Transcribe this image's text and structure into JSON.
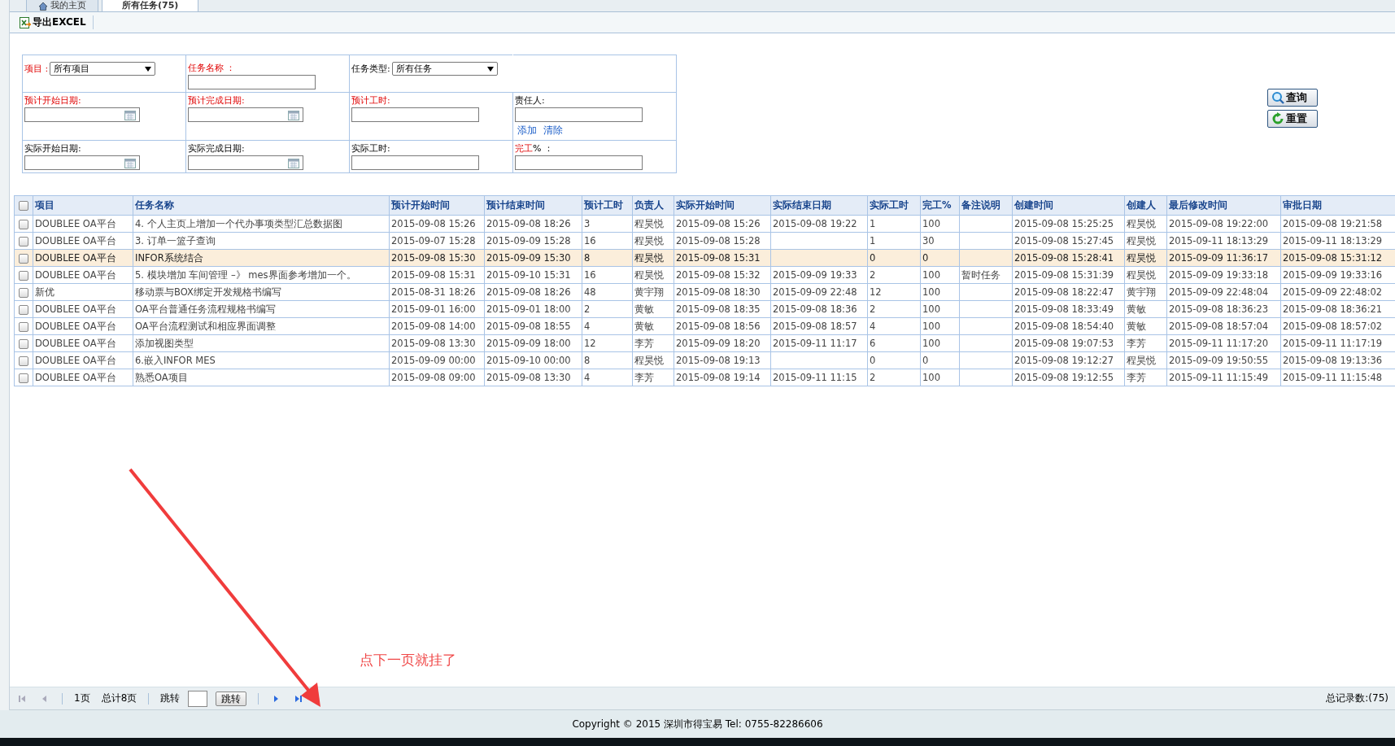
{
  "tabs": [
    {
      "label": "我的主页",
      "selected": false,
      "icon": true
    },
    {
      "label": "所有任务(75)",
      "selected": true,
      "icon": false
    }
  ],
  "toolbar": {
    "export_button": "导出EXCEL"
  },
  "filters": {
    "rows": [
      [
        {
          "label": "项目 :",
          "required": true,
          "kind": "select",
          "value": "所有项目"
        },
        {
          "label": "任务名称 ：",
          "required": true,
          "kind": "text"
        },
        {
          "label": "任务类型:",
          "required": false,
          "kind": "select",
          "value": "所有任务"
        }
      ],
      [
        {
          "label": "预计开始日期:",
          "required": true,
          "kind": "date"
        },
        {
          "label": "预计完成日期:",
          "required": true,
          "kind": "date"
        },
        {
          "label": "预计工时:",
          "required": true,
          "kind": "text"
        },
        {
          "label": "责任人:",
          "required": false,
          "kind": "person",
          "links": [
            "添加",
            "清除"
          ]
        }
      ],
      [
        {
          "label": "实际开始日期:",
          "required": false,
          "kind": "date"
        },
        {
          "label": "实际完成日期:",
          "required": false,
          "kind": "date"
        },
        {
          "label": "实际工时:",
          "required": false,
          "kind": "text"
        },
        {
          "label": "完工",
          "suffix": "% ：",
          "required": true,
          "kind": "text"
        }
      ]
    ],
    "buttons": [
      {
        "label": "查询",
        "kind": "search"
      },
      {
        "label": "重置",
        "kind": "reset"
      }
    ]
  },
  "table": {
    "select_all": {
      "checked": false
    },
    "columns": [
      "项目",
      "任务名称",
      "预计开始时间",
      "预计结束时间",
      "预计工时",
      "负责人",
      "实际开始时间",
      "实际结束日期",
      "实际工时",
      "完工%",
      "备注说明",
      "创建时间",
      "创建人",
      "最后修改时间",
      "审批日期"
    ],
    "rows": [
      {
        "checked": false,
        "selected": false,
        "cells": [
          "DOUBLEE OA平台",
          "4. 个人主页上增加一个代办事项类型汇总数据图",
          "2015-09-08 15:26",
          "2015-09-08 18:26",
          "3",
          "程昊悦",
          "2015-09-08 15:26",
          "2015-09-08 19:22",
          "1",
          "100",
          "",
          "2015-09-08 15:25:25",
          "程昊悦",
          "2015-09-08 19:22:00",
          "2015-09-08 19:21:58"
        ]
      },
      {
        "checked": false,
        "selected": false,
        "cells": [
          "DOUBLEE OA平台",
          "3. 订单一篮子查询",
          "2015-09-07 15:28",
          "2015-09-09 15:28",
          "16",
          "程昊悦",
          "2015-09-08 15:28",
          "",
          "1",
          "30",
          "",
          "2015-09-08 15:27:45",
          "程昊悦",
          "2015-09-11 18:13:29",
          "2015-09-11 18:13:29"
        ]
      },
      {
        "checked": false,
        "selected": true,
        "cells": [
          "DOUBLEE OA平台",
          "INFOR系统结合",
          "2015-09-08 15:30",
          "2015-09-09 15:30",
          "8",
          "程昊悦",
          "2015-09-08 15:31",
          "",
          "0",
          "0",
          "",
          "2015-09-08 15:28:41",
          "程昊悦",
          "2015-09-09 11:36:17",
          "2015-09-08 15:31:12"
        ]
      },
      {
        "checked": false,
        "selected": false,
        "cells": [
          "DOUBLEE OA平台",
          "5. 模块增加 车间管理 –》 mes界面参考增加一个。",
          "2015-09-08 15:31",
          "2015-09-10 15:31",
          "16",
          "程昊悦",
          "2015-09-08 15:32",
          "2015-09-09 19:33",
          "2",
          "100",
          "暂时任务",
          "2015-09-08 15:31:39",
          "程昊悦",
          "2015-09-09 19:33:18",
          "2015-09-09 19:33:16"
        ]
      },
      {
        "checked": false,
        "selected": false,
        "cells": [
          "新优",
          "移动票与BOX绑定开发规格书编写",
          "2015-08-31 18:26",
          "2015-09-08 18:26",
          "48",
          "黄宇翔",
          "2015-09-08 18:30",
          "2015-09-09 22:48",
          "12",
          "100",
          "",
          "2015-09-08 18:22:47",
          "黄宇翔",
          "2015-09-09 22:48:04",
          "2015-09-09 22:48:02"
        ]
      },
      {
        "checked": false,
        "selected": false,
        "cells": [
          "DOUBLEE OA平台",
          "OA平台普通任务流程规格书编写",
          "2015-09-01 16:00",
          "2015-09-01 18:00",
          "2",
          "黄敏",
          "2015-09-08 18:35",
          "2015-09-08 18:36",
          "2",
          "100",
          "",
          "2015-09-08 18:33:49",
          "黄敏",
          "2015-09-08 18:36:23",
          "2015-09-08 18:36:21"
        ]
      },
      {
        "checked": false,
        "selected": false,
        "cells": [
          "DOUBLEE OA平台",
          "OA平台流程测试和相应界面调整",
          "2015-09-08 14:00",
          "2015-09-08 18:55",
          "4",
          "黄敏",
          "2015-09-08 18:56",
          "2015-09-08 18:57",
          "4",
          "100",
          "",
          "2015-09-08 18:54:40",
          "黄敏",
          "2015-09-08 18:57:04",
          "2015-09-08 18:57:02"
        ]
      },
      {
        "checked": false,
        "selected": false,
        "cells": [
          "DOUBLEE OA平台",
          "添加视图类型",
          "2015-09-08 13:30",
          "2015-09-09 18:00",
          "12",
          "李芳",
          "2015-09-09 18:20",
          "2015-09-11 11:17",
          "6",
          "100",
          "",
          "2015-09-08 19:07:53",
          "李芳",
          "2015-09-11 11:17:20",
          "2015-09-11 11:17:19"
        ]
      },
      {
        "checked": false,
        "selected": false,
        "cells": [
          "DOUBLEE OA平台",
          "6.嵌入INFOR MES",
          "2015-09-09 00:00",
          "2015-09-10 00:00",
          "8",
          "程昊悦",
          "2015-09-08 19:13",
          "",
          "0",
          "0",
          "",
          "2015-09-08 19:12:27",
          "程昊悦",
          "2015-09-09 19:50:55",
          "2015-09-08 19:13:36"
        ]
      },
      {
        "checked": false,
        "selected": false,
        "cells": [
          "DOUBLEE OA平台",
          "熟悉OA项目",
          "2015-09-08 09:00",
          "2015-09-08 13:30",
          "4",
          "李芳",
          "2015-09-08 19:14",
          "2015-09-11 11:15",
          "2",
          "100",
          "",
          "2015-09-08 19:12:55",
          "李芳",
          "2015-09-11 11:15:49",
          "2015-09-11 11:15:48"
        ]
      }
    ]
  },
  "annotation": {
    "text": "点下一页就挂了"
  },
  "pager": {
    "first_disabled": true,
    "prev_disabled": true,
    "next_disabled": false,
    "last_disabled": false,
    "page": "1页",
    "total_pages": "总计8页",
    "jump_label": "跳转",
    "jump_button": "跳转",
    "total_records": "总记录数:(75)"
  },
  "footer": "Copyright © 2015 深圳市得宝易 Tel: 0755-82286606"
}
